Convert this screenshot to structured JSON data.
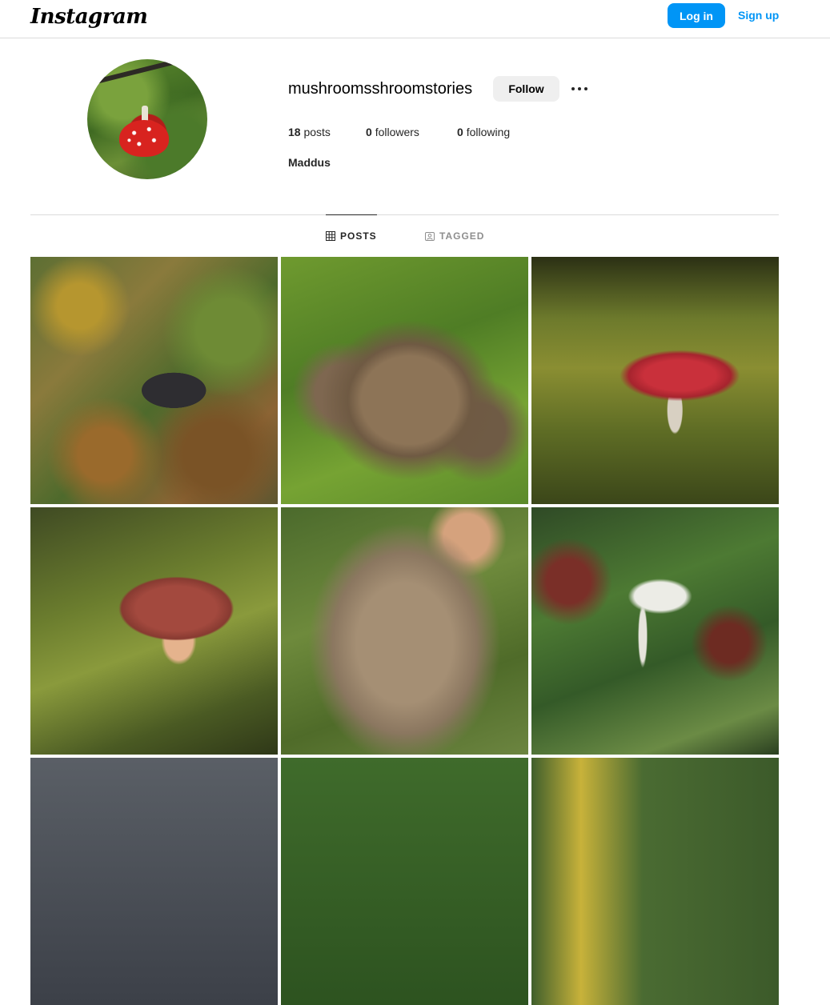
{
  "header": {
    "logo_text": "Instagram",
    "login_label": "Log in",
    "signup_label": "Sign up"
  },
  "profile": {
    "username": "mushroomsshroomstories",
    "follow_label": "Follow",
    "more_icon": "more-horizontal-icon",
    "stats": {
      "posts_count": "18",
      "posts_label": "posts",
      "followers_count": "0",
      "followers_label": "followers",
      "following_count": "0",
      "following_label": "following"
    },
    "full_name": "Maddus"
  },
  "tabs": [
    {
      "label": "POSTS",
      "icon": "grid-icon",
      "active": true
    },
    {
      "label": "TAGGED",
      "icon": "tagged-icon",
      "active": false
    }
  ],
  "colors": {
    "accent": "#0095f6",
    "follow_bg": "#efefef",
    "divider": "#dbdbdb",
    "muted_text": "#8e8e8e"
  }
}
